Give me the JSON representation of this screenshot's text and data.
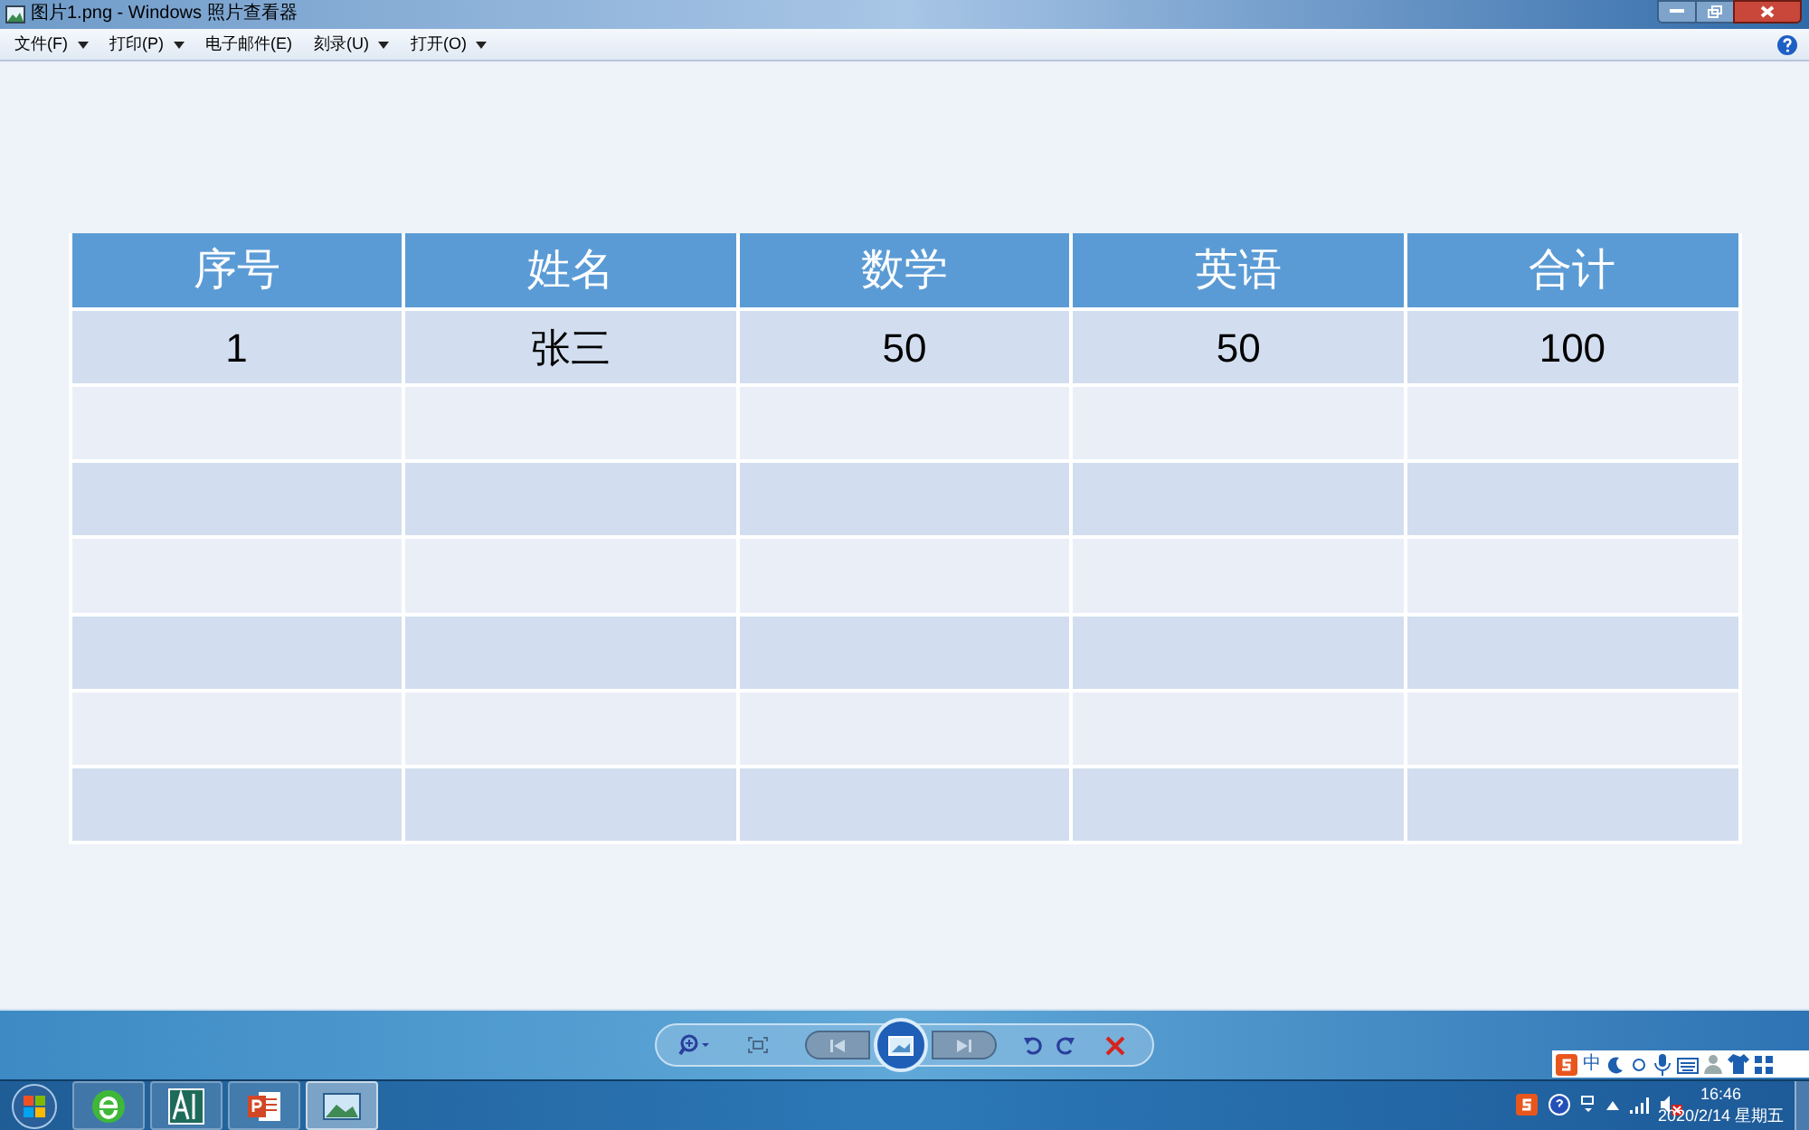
{
  "window": {
    "title": "图片1.png - Windows 照片查看器"
  },
  "menu": [
    {
      "label": "文件(F)",
      "dropdown": true
    },
    {
      "label": "打印(P)",
      "dropdown": true
    },
    {
      "label": "电子邮件(E)",
      "dropdown": false
    },
    {
      "label": "刻录(U)",
      "dropdown": true
    },
    {
      "label": "打开(O)",
      "dropdown": true
    }
  ],
  "table": {
    "columns": [
      "序号",
      "姓名",
      "数学",
      "英语",
      "合计"
    ],
    "rows": [
      {
        "kind": "data",
        "cells": [
          "1",
          "张三",
          "50",
          "50",
          "100"
        ]
      },
      {
        "kind": "blank"
      },
      {
        "kind": "blank"
      },
      {
        "kind": "blank"
      },
      {
        "kind": "blank"
      },
      {
        "kind": "blank"
      },
      {
        "kind": "blank"
      }
    ]
  },
  "ime_bar": {
    "mode": "中"
  },
  "clock": {
    "time": "16:46",
    "date": "2020/2/14 星期五"
  }
}
